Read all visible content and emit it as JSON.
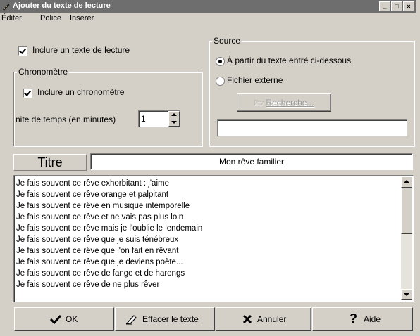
{
  "window": {
    "title": "Ajouter du texte de lecture",
    "controls": {
      "minimize": "_",
      "maximize": "□",
      "close": "×"
    }
  },
  "menu": {
    "items": [
      {
        "label": "Éditer"
      },
      {
        "label": "Police"
      },
      {
        "label": "Insérer"
      }
    ]
  },
  "reading": {
    "include_label": "Inclure un texte de lecture",
    "include_checked": true
  },
  "chrono": {
    "group_title": "Chronomètre",
    "include_label": "Inclure un chronomètre",
    "include_checked": true,
    "limit_label": "nite de temps (en minutes)",
    "limit_value": "1"
  },
  "source": {
    "group_title": "Source",
    "option_text_label": "À partir du texte entré ci-dessous",
    "option_file_label": "Fichier externe",
    "selected": "text",
    "browse_label": "Recherche...",
    "file_path": ""
  },
  "title_row": {
    "label": "Titre",
    "value": "Mon rêve familier"
  },
  "body_lines": [
    "Je fais souvent ce rêve exhorbitant : j'aime",
    "Je fais souvent ce rêve orange et palpitant",
    "Je fais souvent ce rêve en musique intemporelle",
    "Je fais souvent ce rêve et ne vais pas plus loin",
    "Je fais souvent ce rêve mais je l'oublie le lendemain",
    "Je fais souvent ce rêve que je suis ténébreux",
    "Je fais souvent ce rêve que l'on fait en rêvant",
    "Je fais souvent ce rêve que je deviens poète...",
    "Je fais souvent ce rêve de fange et de harengs",
    "Je fais souvent ce rêve de ne plus rêver"
  ],
  "buttons": {
    "ok": "OK",
    "clear": "Effacer le texte",
    "cancel": "Annuler",
    "help": "Aide"
  }
}
